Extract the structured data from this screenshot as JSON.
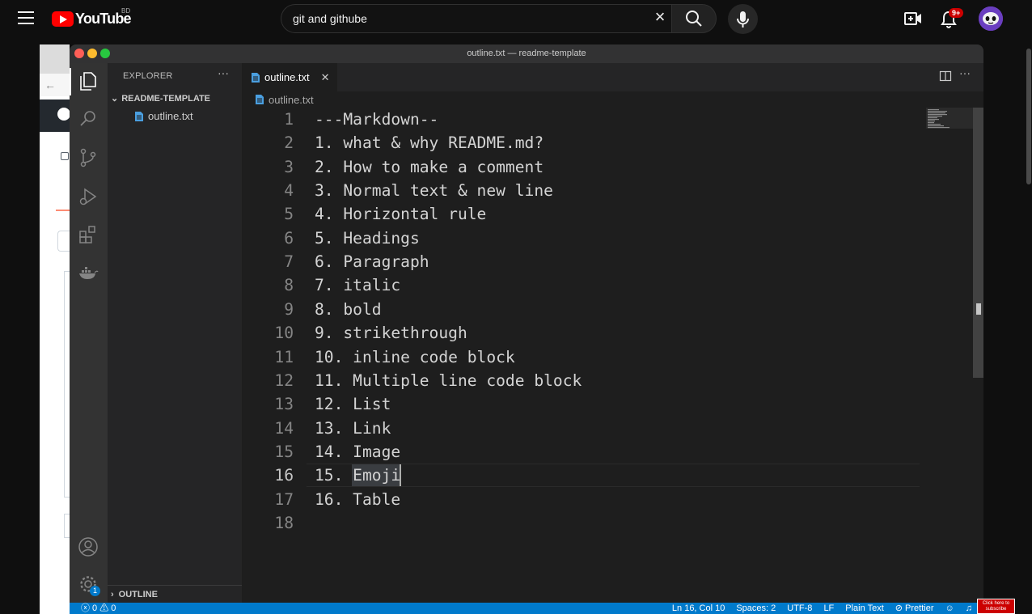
{
  "youtube": {
    "logo_text": "YouTube",
    "country": "BD",
    "search_value": "git and githube",
    "notification_count": "9+",
    "subscribe_text": "Click here to subscribe"
  },
  "vscode": {
    "window_title": "outline.txt — readme-template",
    "explorer_title": "EXPLORER",
    "folder_name": "README-TEMPLATE",
    "file_name": "outline.txt",
    "outline_section": "OUTLINE",
    "tab_label": "outline.txt",
    "breadcrumb": "outline.txt",
    "settings_badge": "1",
    "lines": [
      {
        "n": "1",
        "text": "---Markdown--"
      },
      {
        "n": "2",
        "text": "1. what & why README.md?"
      },
      {
        "n": "3",
        "text": "2. How to make a comment"
      },
      {
        "n": "4",
        "text": "3. Normal text & new line"
      },
      {
        "n": "5",
        "text": "4. Horizontal rule"
      },
      {
        "n": "6",
        "text": "5. Headings"
      },
      {
        "n": "7",
        "text": "6. Paragraph"
      },
      {
        "n": "8",
        "text": "7. italic"
      },
      {
        "n": "9",
        "text": "8. bold"
      },
      {
        "n": "10",
        "text": "9. strikethrough"
      },
      {
        "n": "11",
        "text": "10. inline code block"
      },
      {
        "n": "12",
        "text": "11. Multiple line code block"
      },
      {
        "n": "13",
        "text": "12. List"
      },
      {
        "n": "14",
        "text": "13. Link"
      },
      {
        "n": "15",
        "text": "14. Image"
      },
      {
        "n": "16",
        "text": "15. Emoji"
      },
      {
        "n": "17",
        "text": "16. Table"
      },
      {
        "n": "18",
        "text": ""
      }
    ],
    "status": {
      "problems": "ⓧ 0 ⚠ 0",
      "position": "Ln 16, Col 10",
      "spaces": "Spaces: 2",
      "encoding": "UTF-8",
      "eol": "LF",
      "language": "Plain Text",
      "formatter": "⊘ Prettier"
    }
  }
}
